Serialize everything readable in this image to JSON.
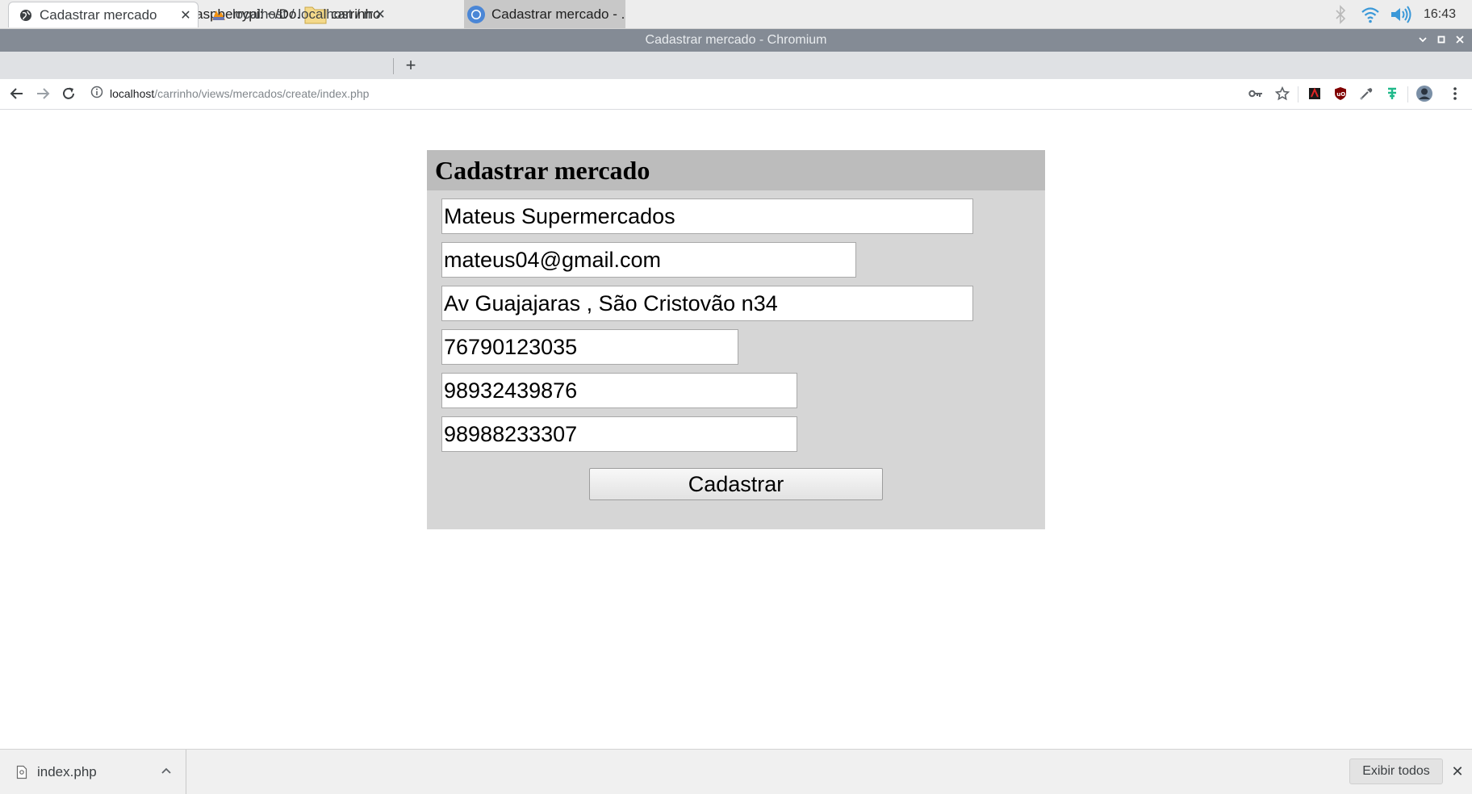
{
  "taskbar": {
    "tasks": [
      {
        "label": "pi@raspberrypi: ~/Do...",
        "icon": "terminal-icon"
      },
      {
        "label": "carrinho",
        "icon": "folder-icon"
      },
      {
        "label": "Cadastrar mercado - ...",
        "icon": "chromium-icon"
      }
    ],
    "launchers": [
      "raspberry-menu-icon",
      "web-browser-icon",
      "file-manager-icon",
      "terminal-icon"
    ],
    "tray": [
      "bluetooth-icon",
      "wifi-icon",
      "volume-icon"
    ],
    "clock": "16:43"
  },
  "window": {
    "title": "Cadastrar mercado - Chromium"
  },
  "tabs": [
    {
      "title": "Cadastrar mercado",
      "active": true,
      "icon": "globe-icon"
    },
    {
      "title": "localhost / localhost / m",
      "active": false,
      "icon": "phpmyadmin-icon"
    }
  ],
  "address_bar": {
    "host": "localhost",
    "path": "/carrinho/views/mercados/create/index.php"
  },
  "form": {
    "title": "Cadastrar mercado",
    "fields": [
      {
        "value": "Mateus Supermercados"
      },
      {
        "value": "mateus04@gmail.com"
      },
      {
        "value": "Av Guajajaras , São Cristovão n34"
      },
      {
        "value": "76790123035"
      },
      {
        "value": "98932439876"
      },
      {
        "value": "98988233307"
      }
    ],
    "submit_label": "Cadastrar"
  },
  "downloads": {
    "file_name": "index.php",
    "show_all_label": "Exibir todos"
  },
  "colors": {
    "card_bg": "#d6d6d6",
    "card_header_bg": "#bcbcbc",
    "window_titlebar": "#848b95",
    "tabstrip_bg": "#dfe1e4"
  }
}
